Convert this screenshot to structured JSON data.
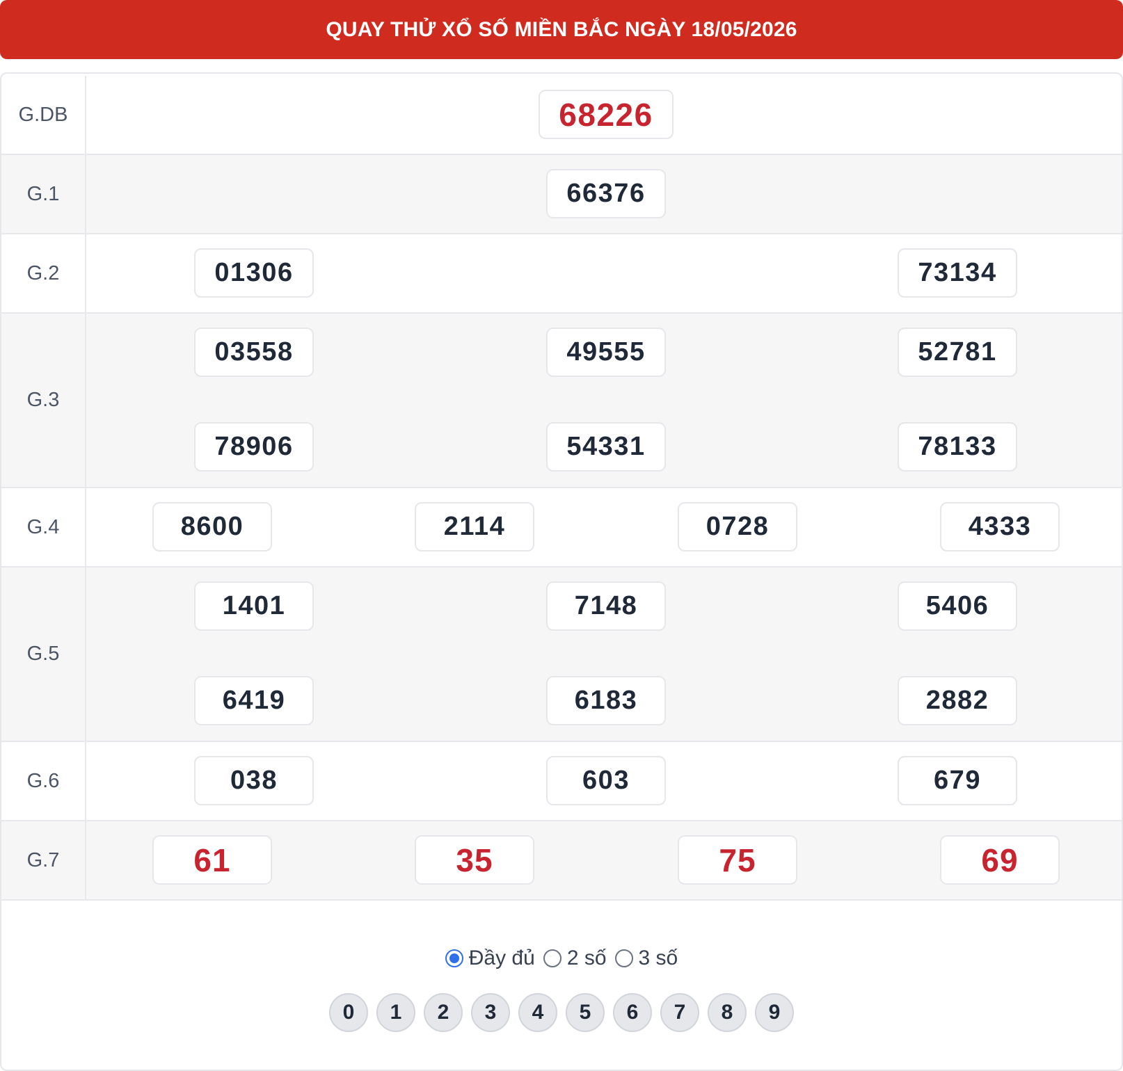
{
  "header": {
    "title": "QUAY THỬ XỔ SỐ MIỀN BẮC NGÀY 18/05/2026"
  },
  "prizes": {
    "gdb": {
      "label": "G.DB",
      "numbers": [
        "68226"
      ]
    },
    "g1": {
      "label": "G.1",
      "numbers": [
        "66376"
      ]
    },
    "g2": {
      "label": "G.2",
      "numbers": [
        "01306",
        "73134"
      ]
    },
    "g3": {
      "label": "G.3",
      "numbers": [
        "03558",
        "49555",
        "52781",
        "78906",
        "54331",
        "78133"
      ]
    },
    "g4": {
      "label": "G.4",
      "numbers": [
        "8600",
        "2114",
        "0728",
        "4333"
      ]
    },
    "g5": {
      "label": "G.5",
      "numbers": [
        "1401",
        "7148",
        "5406",
        "6419",
        "6183",
        "2882"
      ]
    },
    "g6": {
      "label": "G.6",
      "numbers": [
        "038",
        "603",
        "679"
      ]
    },
    "g7": {
      "label": "G.7",
      "numbers": [
        "61",
        "35",
        "75",
        "69"
      ]
    }
  },
  "display_options": {
    "selected": "Đầy đủ",
    "items": [
      {
        "label": "Đầy đủ",
        "checked": true
      },
      {
        "label": "2 số",
        "checked": false
      },
      {
        "label": "3 số",
        "checked": false
      }
    ]
  },
  "digit_filter": [
    "0",
    "1",
    "2",
    "3",
    "4",
    "5",
    "6",
    "7",
    "8",
    "9"
  ],
  "colors": {
    "header_bg": "#cf2b1f",
    "highlight_red": "#c8242f",
    "radio_accent": "#2f6fe8"
  }
}
